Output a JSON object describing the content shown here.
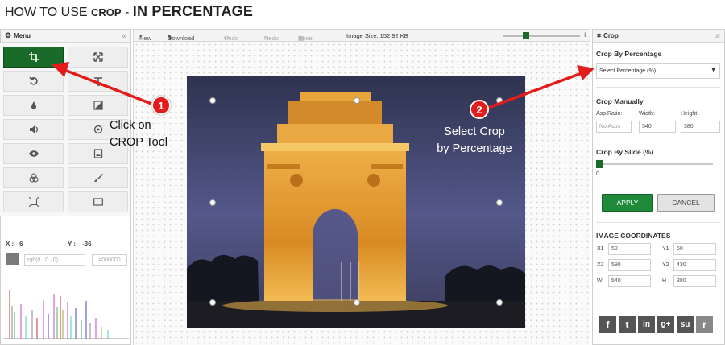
{
  "heading": {
    "prefix": "HOW TO USE ",
    "tool": "CROP",
    "dash": " - ",
    "topic": "IN PERCENTAGE"
  },
  "menu_panel": {
    "title": "Menu",
    "tools": [
      {
        "icon": "crop-icon",
        "active": true
      },
      {
        "icon": "resize-icon",
        "active": false
      },
      {
        "icon": "rotate-icon",
        "active": false
      },
      {
        "icon": "text-icon",
        "active": false
      },
      {
        "icon": "drop-icon",
        "active": false
      },
      {
        "icon": "contrast-icon",
        "active": false
      },
      {
        "icon": "sound-icon",
        "active": false
      },
      {
        "icon": "target-icon",
        "active": false
      },
      {
        "icon": "eye-icon",
        "active": false
      },
      {
        "icon": "image-icon",
        "active": false
      },
      {
        "icon": "circles-icon",
        "active": false
      },
      {
        "icon": "brush-icon",
        "active": false
      },
      {
        "icon": "frame-icon",
        "active": false
      },
      {
        "icon": "rectangle-icon",
        "active": false
      }
    ],
    "x_label": "X :",
    "x_value": "6",
    "y_label": "Y :",
    "y_value": "-36",
    "rgb_value": "rgb(0 , 0 , 0)",
    "hex_value": "#000000",
    "swatch_color": "#7a7a7a"
  },
  "toolbar": {
    "new_label": "New",
    "download_label": "Download",
    "undo_label": "Undo",
    "redo_label": "Redo",
    "reset_label": "Reset",
    "image_size": "Image Size: 152.92 KB",
    "zoom_level": 0.3
  },
  "crop_panel": {
    "title": "Crop",
    "by_percentage_title": "Crop By Percentage",
    "percentage_placeholder": "Select Percentage (%)",
    "manual_title": "Crop Manually",
    "aspect_label": "Asp.Ratio:",
    "aspect_value": "No Asps",
    "width_label": "Width:",
    "width_value": "540",
    "height_label": "Height:",
    "height_value": "380",
    "slide_title": "Crop By Slide (%)",
    "slide_value": "0",
    "apply_label": "APPLY",
    "cancel_label": "CANCEL",
    "coords_title": "IMAGE COORDINATES",
    "x1_label": "X1",
    "x1_value": "50",
    "y1_label": "Y1",
    "y1_value": "50",
    "x2_label": "X2",
    "x2_value": "590",
    "y2_label": "Y2",
    "y2_value": "430",
    "w_label": "W",
    "w_value": "540",
    "h_label": "H",
    "h_value": "380",
    "social": [
      {
        "icon": "facebook-icon",
        "glyph": "f"
      },
      {
        "icon": "twitter-icon",
        "glyph": "t"
      },
      {
        "icon": "linkedin-icon",
        "glyph": "in"
      },
      {
        "icon": "googleplus-icon",
        "glyph": "g+"
      },
      {
        "icon": "stumbleupon-icon",
        "glyph": "su"
      },
      {
        "icon": "reddit-icon",
        "glyph": "r"
      }
    ]
  },
  "callouts": {
    "step1_number": "1",
    "step1_line1": "Click on",
    "step1_line2": "CROP Tool",
    "step2_number": "2",
    "step2_line1": "Select Crop",
    "step2_line2": "by Percentage"
  },
  "colors": {
    "accent_green": "#1a6a2a",
    "arrow_red": "#e41b1b"
  }
}
